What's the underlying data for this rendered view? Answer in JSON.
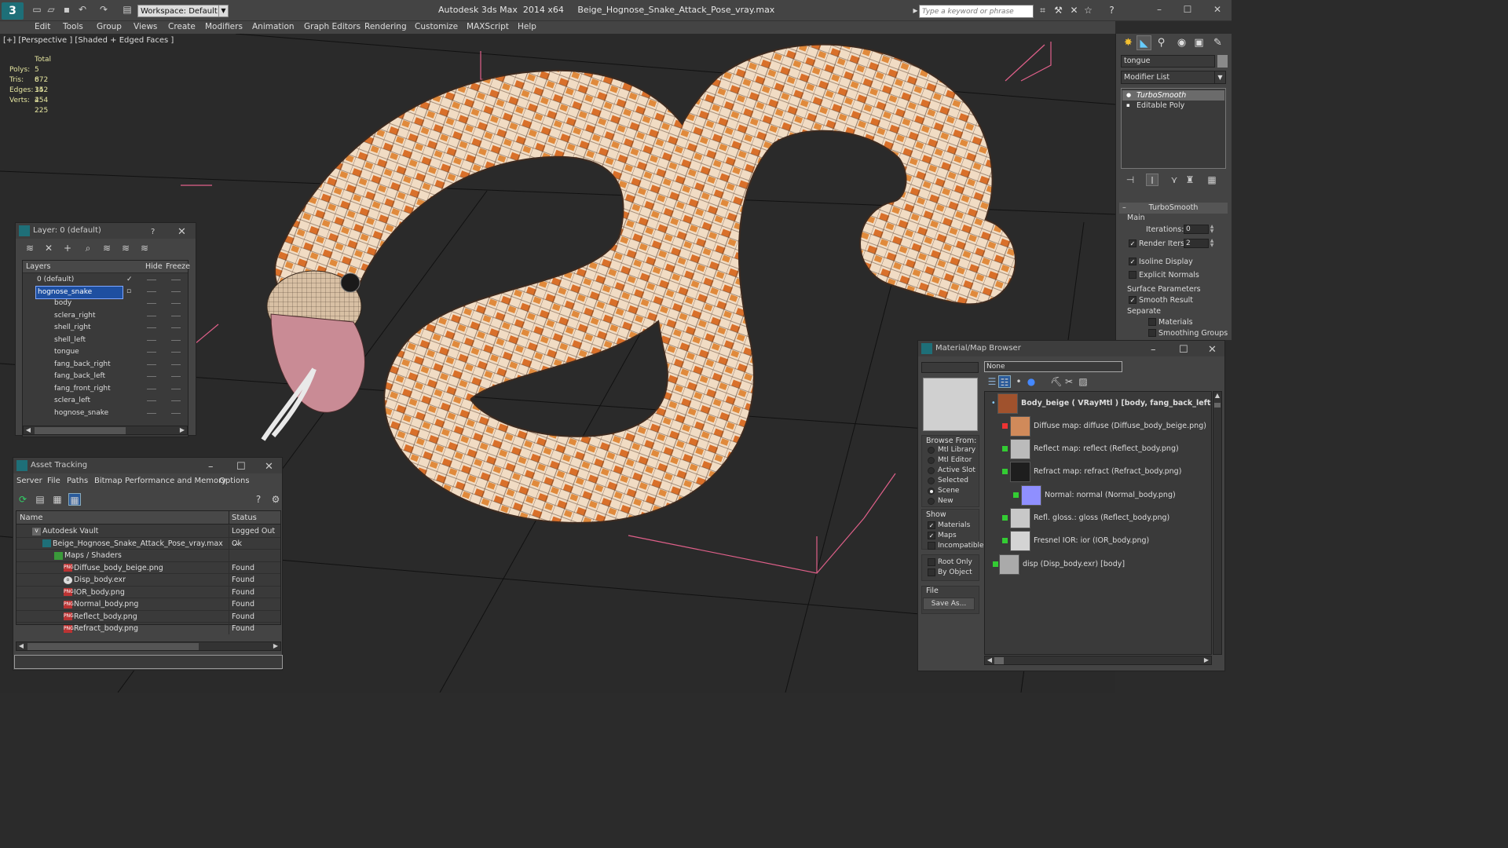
{
  "app": {
    "logo": "3",
    "workspace_label": "Workspace: Default",
    "title_app": "Autodesk 3ds Max  2014 x64",
    "title_file": "Beige_Hognose_Snake_Attack_Pose_vray.max",
    "search_placeholder": "Type a keyword or phrase"
  },
  "menu": [
    "Edit",
    "Tools",
    "Group",
    "Views",
    "Create",
    "Modifiers",
    "Animation",
    "Graph Editors",
    "Rendering",
    "Customize",
    "MAXScript",
    "Help"
  ],
  "viewport": {
    "label": "[+] [Perspective ] [Shaded + Edged Faces ]",
    "stats": {
      "total_label": "Total",
      "rows": [
        {
          "k": "Polys:",
          "v": "5 672"
        },
        {
          "k": "Tris:",
          "v": "8 352"
        },
        {
          "k": "Edges:",
          "v": "14 254"
        },
        {
          "k": "Verts:",
          "v": "4 225"
        }
      ]
    }
  },
  "layers": {
    "title": "Layer: 0 (default)",
    "help": "?",
    "columns": {
      "layers": "Layers",
      "hide": "Hide",
      "freeze": "Freeze"
    },
    "rows": [
      "0 (default)",
      "hognose_snake",
      "body",
      "sclera_right",
      "shell_right",
      "shell_left",
      "tongue",
      "fang_back_right",
      "fang_back_left",
      "fang_front_right",
      "sclera_left",
      "hognose_snake"
    ]
  },
  "asset": {
    "title": "Asset Tracking",
    "menu": [
      "Server",
      "File",
      "Paths",
      "Bitmap Performance and Memory",
      "Options"
    ],
    "columns": {
      "name": "Name",
      "status": "Status"
    },
    "rows": [
      {
        "name": "Autodesk Vault",
        "status": "Logged Out ..."
      },
      {
        "name": "Beige_Hognose_Snake_Attack_Pose_vray.max",
        "status": "Ok"
      },
      {
        "name": "Maps / Shaders",
        "status": ""
      },
      {
        "name": "Diffuse_body_beige.png",
        "status": "Found"
      },
      {
        "name": "Disp_body.exr",
        "status": "Found"
      },
      {
        "name": "IOR_body.png",
        "status": "Found"
      },
      {
        "name": "Normal_body.png",
        "status": "Found"
      },
      {
        "name": "Reflect_body.png",
        "status": "Found"
      },
      {
        "name": "Refract_body.png",
        "status": "Found"
      }
    ]
  },
  "command": {
    "object_name": "tongue",
    "modifier_list": "Modifier List",
    "stack": [
      "TurboSmooth",
      "Editable Poly"
    ],
    "rollout": "TurboSmooth",
    "main": "Main",
    "iterations_label": "Iterations:",
    "iterations": "0",
    "render_iters_label": "Render Iters:",
    "render_iters": "2",
    "isoline": "Isoline Display",
    "explicit": "Explicit Normals",
    "surface": "Surface Parameters",
    "smooth": "Smooth Result",
    "separate": "Separate",
    "materials": "Materials",
    "smoothing": "Smoothing Groups"
  },
  "mbrowser": {
    "title": "Material/Map Browser",
    "search": "None",
    "browse_from": "Browse From:",
    "browse_opts": [
      "Mtl Library",
      "Mtl Editor",
      "Active Slot",
      "Selected",
      "Scene",
      "New"
    ],
    "show": "Show",
    "show_opts": [
      "Materials",
      "Maps",
      "Incompatible"
    ],
    "root_only": "Root Only",
    "by_object": "By Object",
    "file": "File",
    "save_as": "Save As...",
    "items": [
      "Body_beige  ( VRayMtl )  [body, fang_back_left, fang",
      "Diffuse map: diffuse (Diffuse_body_beige.png)",
      "Reflect map: reflect (Reflect_body.png)",
      "Refract map: refract (Refract_body.png)",
      "Normal: normal (Normal_body.png)",
      "Refl. gloss.: gloss (Reflect_body.png)",
      "Fresnel IOR: ior (IOR_body.png)",
      "disp (Disp_body.exr)  [body]"
    ]
  },
  "colors": {
    "accent": "#1e6f78",
    "selection": "#1e4fa0",
    "gizmo": "#e0608a",
    "snake_base": "#f2dcc3",
    "snake_spot": "#d9702a"
  }
}
